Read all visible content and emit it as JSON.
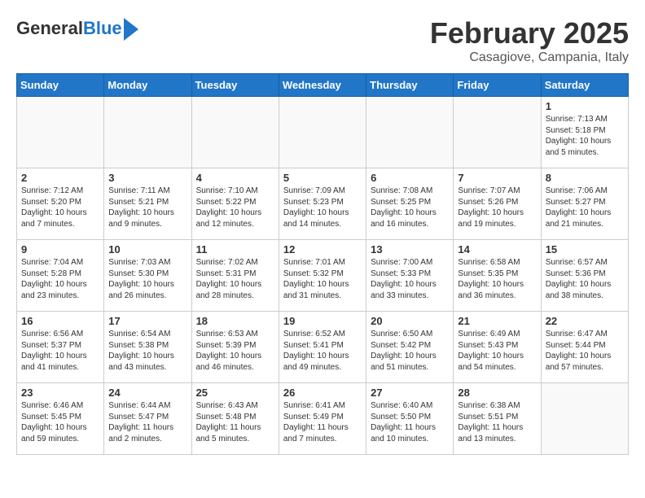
{
  "header": {
    "logo_line1": "General",
    "logo_line2": "Blue",
    "title": "February 2025",
    "subtitle": "Casagiove, Campania, Italy"
  },
  "days_of_week": [
    "Sunday",
    "Monday",
    "Tuesday",
    "Wednesday",
    "Thursday",
    "Friday",
    "Saturday"
  ],
  "weeks": [
    [
      {
        "num": "",
        "info": ""
      },
      {
        "num": "",
        "info": ""
      },
      {
        "num": "",
        "info": ""
      },
      {
        "num": "",
        "info": ""
      },
      {
        "num": "",
        "info": ""
      },
      {
        "num": "",
        "info": ""
      },
      {
        "num": "1",
        "info": "Sunrise: 7:13 AM\nSunset: 5:18 PM\nDaylight: 10 hours\nand 5 minutes."
      }
    ],
    [
      {
        "num": "2",
        "info": "Sunrise: 7:12 AM\nSunset: 5:20 PM\nDaylight: 10 hours\nand 7 minutes."
      },
      {
        "num": "3",
        "info": "Sunrise: 7:11 AM\nSunset: 5:21 PM\nDaylight: 10 hours\nand 9 minutes."
      },
      {
        "num": "4",
        "info": "Sunrise: 7:10 AM\nSunset: 5:22 PM\nDaylight: 10 hours\nand 12 minutes."
      },
      {
        "num": "5",
        "info": "Sunrise: 7:09 AM\nSunset: 5:23 PM\nDaylight: 10 hours\nand 14 minutes."
      },
      {
        "num": "6",
        "info": "Sunrise: 7:08 AM\nSunset: 5:25 PM\nDaylight: 10 hours\nand 16 minutes."
      },
      {
        "num": "7",
        "info": "Sunrise: 7:07 AM\nSunset: 5:26 PM\nDaylight: 10 hours\nand 19 minutes."
      },
      {
        "num": "8",
        "info": "Sunrise: 7:06 AM\nSunset: 5:27 PM\nDaylight: 10 hours\nand 21 minutes."
      }
    ],
    [
      {
        "num": "9",
        "info": "Sunrise: 7:04 AM\nSunset: 5:28 PM\nDaylight: 10 hours\nand 23 minutes."
      },
      {
        "num": "10",
        "info": "Sunrise: 7:03 AM\nSunset: 5:30 PM\nDaylight: 10 hours\nand 26 minutes."
      },
      {
        "num": "11",
        "info": "Sunrise: 7:02 AM\nSunset: 5:31 PM\nDaylight: 10 hours\nand 28 minutes."
      },
      {
        "num": "12",
        "info": "Sunrise: 7:01 AM\nSunset: 5:32 PM\nDaylight: 10 hours\nand 31 minutes."
      },
      {
        "num": "13",
        "info": "Sunrise: 7:00 AM\nSunset: 5:33 PM\nDaylight: 10 hours\nand 33 minutes."
      },
      {
        "num": "14",
        "info": "Sunrise: 6:58 AM\nSunset: 5:35 PM\nDaylight: 10 hours\nand 36 minutes."
      },
      {
        "num": "15",
        "info": "Sunrise: 6:57 AM\nSunset: 5:36 PM\nDaylight: 10 hours\nand 38 minutes."
      }
    ],
    [
      {
        "num": "16",
        "info": "Sunrise: 6:56 AM\nSunset: 5:37 PM\nDaylight: 10 hours\nand 41 minutes."
      },
      {
        "num": "17",
        "info": "Sunrise: 6:54 AM\nSunset: 5:38 PM\nDaylight: 10 hours\nand 43 minutes."
      },
      {
        "num": "18",
        "info": "Sunrise: 6:53 AM\nSunset: 5:39 PM\nDaylight: 10 hours\nand 46 minutes."
      },
      {
        "num": "19",
        "info": "Sunrise: 6:52 AM\nSunset: 5:41 PM\nDaylight: 10 hours\nand 49 minutes."
      },
      {
        "num": "20",
        "info": "Sunrise: 6:50 AM\nSunset: 5:42 PM\nDaylight: 10 hours\nand 51 minutes."
      },
      {
        "num": "21",
        "info": "Sunrise: 6:49 AM\nSunset: 5:43 PM\nDaylight: 10 hours\nand 54 minutes."
      },
      {
        "num": "22",
        "info": "Sunrise: 6:47 AM\nSunset: 5:44 PM\nDaylight: 10 hours\nand 57 minutes."
      }
    ],
    [
      {
        "num": "23",
        "info": "Sunrise: 6:46 AM\nSunset: 5:45 PM\nDaylight: 10 hours\nand 59 minutes."
      },
      {
        "num": "24",
        "info": "Sunrise: 6:44 AM\nSunset: 5:47 PM\nDaylight: 11 hours\nand 2 minutes."
      },
      {
        "num": "25",
        "info": "Sunrise: 6:43 AM\nSunset: 5:48 PM\nDaylight: 11 hours\nand 5 minutes."
      },
      {
        "num": "26",
        "info": "Sunrise: 6:41 AM\nSunset: 5:49 PM\nDaylight: 11 hours\nand 7 minutes."
      },
      {
        "num": "27",
        "info": "Sunrise: 6:40 AM\nSunset: 5:50 PM\nDaylight: 11 hours\nand 10 minutes."
      },
      {
        "num": "28",
        "info": "Sunrise: 6:38 AM\nSunset: 5:51 PM\nDaylight: 11 hours\nand 13 minutes."
      },
      {
        "num": "",
        "info": ""
      }
    ]
  ]
}
